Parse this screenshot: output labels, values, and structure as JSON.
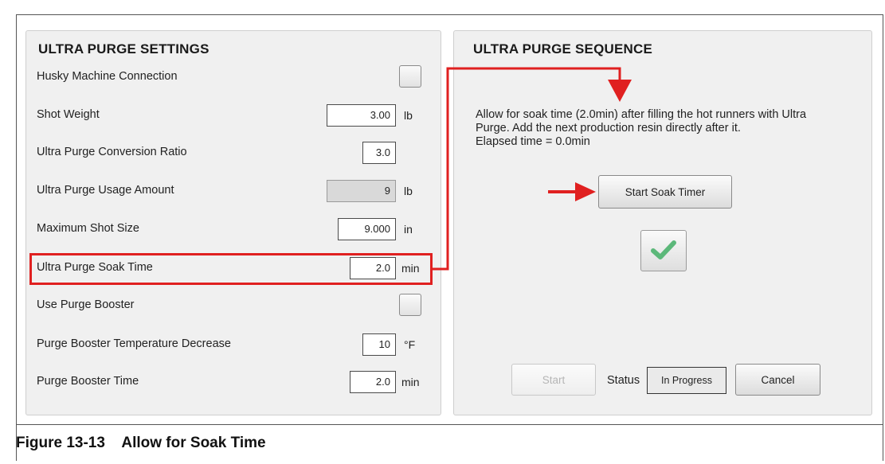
{
  "settings": {
    "title": "ULTRA PURGE SETTINGS",
    "rows": [
      {
        "label": "Husky Machine Connection"
      },
      {
        "label": "Shot Weight",
        "value": "3.00",
        "unit": "lb"
      },
      {
        "label": "Ultra Purge Conversion Ratio",
        "value": "3.0"
      },
      {
        "label": "Ultra Purge Usage Amount",
        "value": "9",
        "unit": "lb"
      },
      {
        "label": "Maximum Shot Size",
        "value": "9.000",
        "unit": "in"
      },
      {
        "label": "Ultra Purge Soak Time",
        "value": "2.0",
        "unit": "min"
      },
      {
        "label": "Use Purge Booster"
      },
      {
        "label": "Purge Booster Temperature Decrease",
        "value": "10",
        "unit": "°F"
      },
      {
        "label": "Purge Booster Time",
        "value": "2.0",
        "unit": "min"
      }
    ]
  },
  "sequence": {
    "title": "ULTRA PURGE SEQUENCE",
    "message_line1": "Allow for soak time (2.0min) after filling the hot runners with Ultra",
    "message_line2": "Purge. Add the next production resin directly after it.",
    "message_line3": "Elapsed time = 0.0min",
    "start_soak_timer_label": "Start Soak Timer",
    "start_label": "Start",
    "status_label": "Status",
    "status_value": "In Progress",
    "cancel_label": "Cancel"
  },
  "caption": "Figure 13-13    Allow for Soak Time",
  "colors": {
    "annotation_red": "#e02020",
    "check_green": "#5cb87a"
  }
}
